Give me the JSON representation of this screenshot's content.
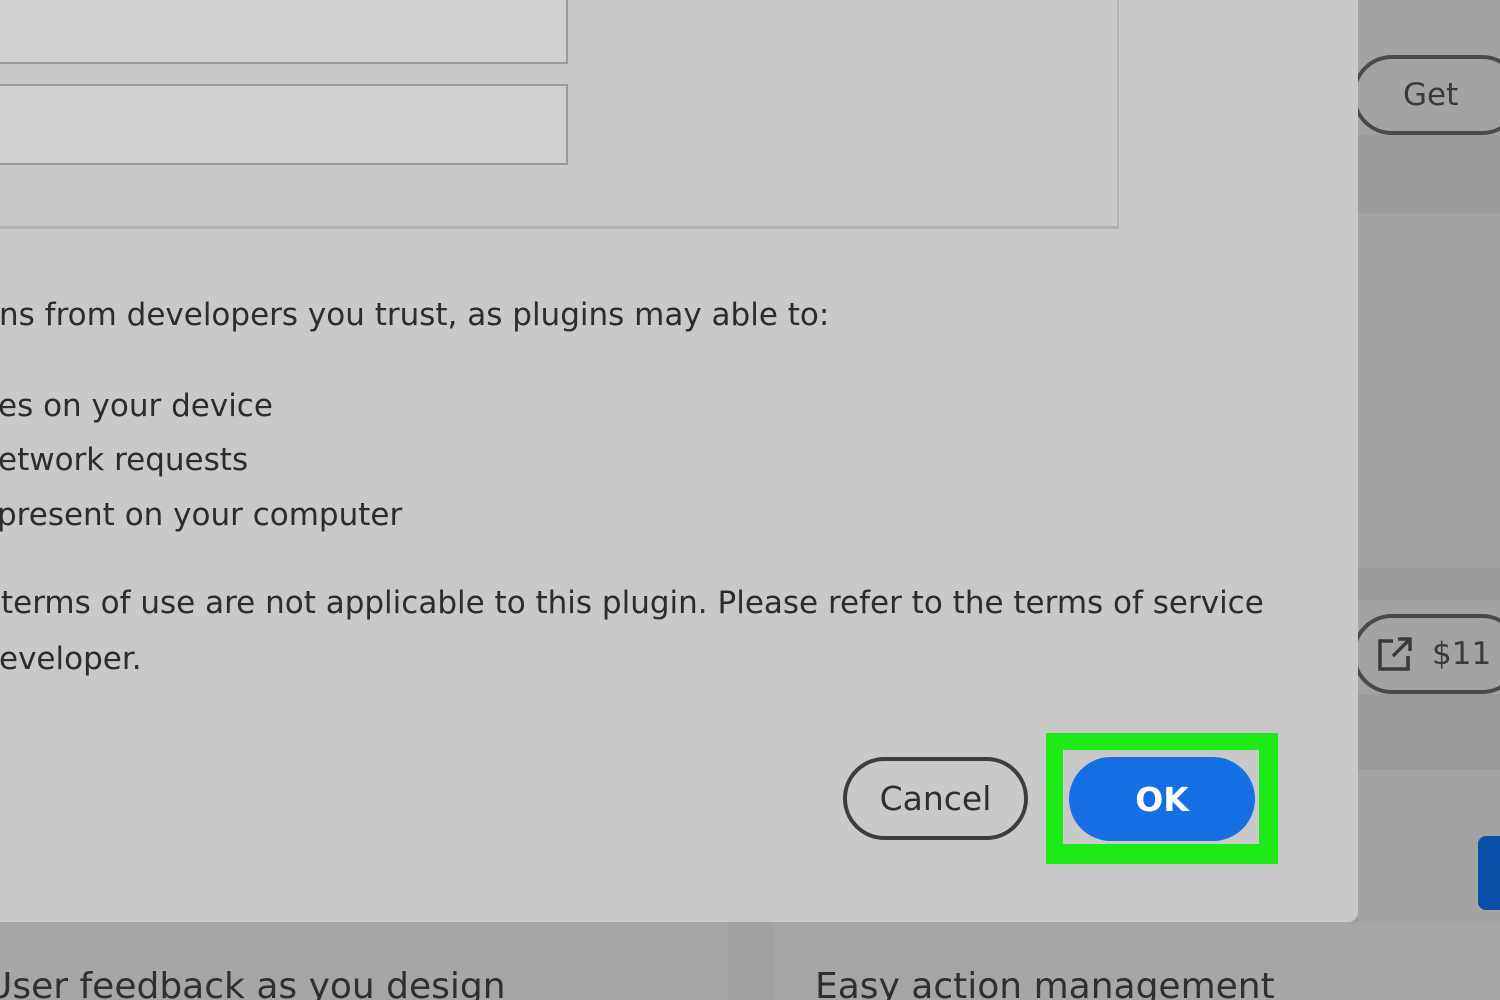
{
  "background": {
    "get_button": "Get",
    "price_button": "$11",
    "bottom_left_card": "User feedback as you design",
    "bottom_right_card": "Easy action management"
  },
  "dialog": {
    "intro": "ns from developers you trust, as plugins may able to:",
    "bullets": [
      "es on your device",
      "etwork requests",
      "present on your computer"
    ],
    "terms_line_1": "terms of use are not applicable to this plugin. Please refer to the terms of service",
    "terms_line_2": "eveloper.",
    "cancel_label": "Cancel",
    "ok_label": "OK"
  },
  "colors": {
    "ok_button": "#1670e3",
    "highlight": "#1dea16",
    "dialog_bg": "#c9c9c9"
  },
  "icons": {
    "price_button_icon": "external-link-icon"
  }
}
